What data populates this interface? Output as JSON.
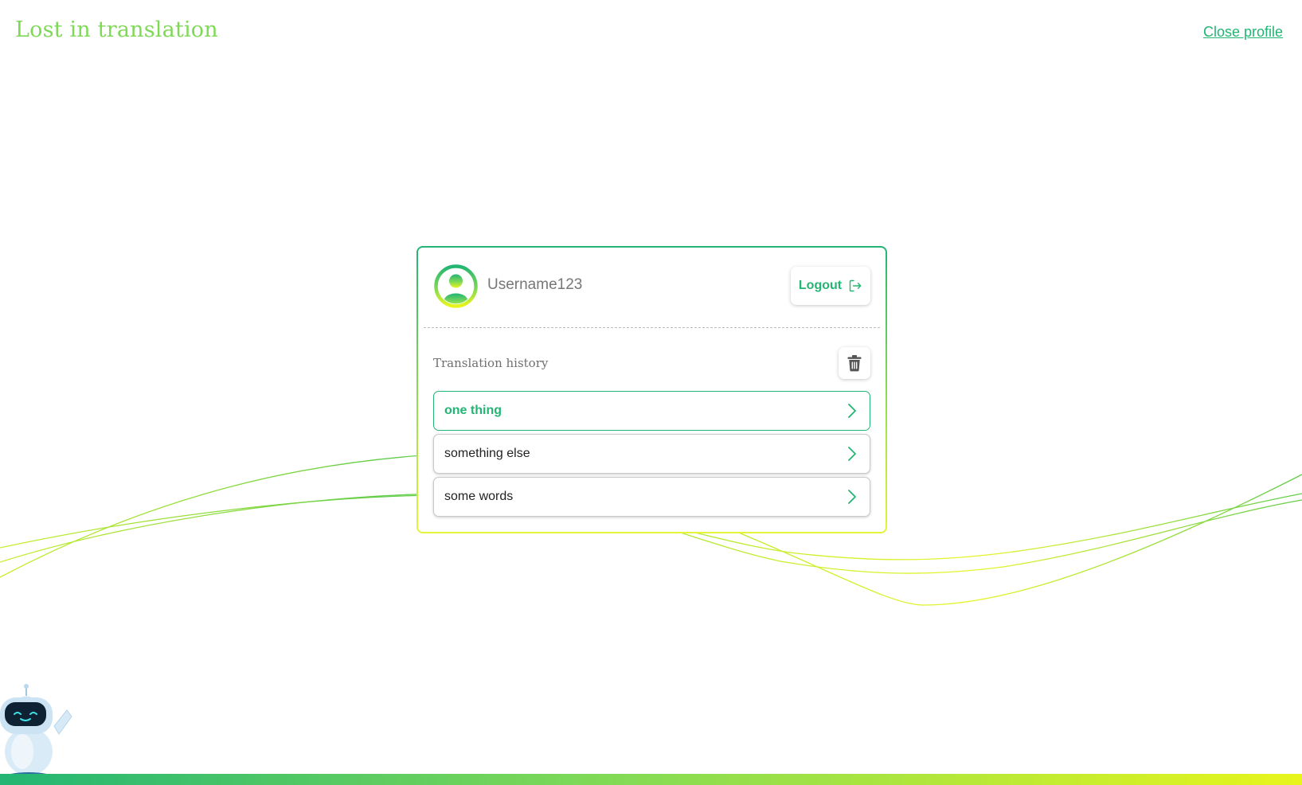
{
  "header": {
    "app_title": "Lost in translation",
    "close_profile_label": "Close profile"
  },
  "profile": {
    "username": "Username123",
    "logout_label": "Logout"
  },
  "history": {
    "title": "Translation history",
    "items": [
      {
        "label": "one thing",
        "active": true
      },
      {
        "label": "something else",
        "active": false
      },
      {
        "label": "some words",
        "active": false
      }
    ]
  },
  "icons": {
    "avatar": "user-circle-icon",
    "logout": "logout-icon",
    "trash": "trash-icon",
    "chevron": "chevron-right-icon",
    "mascot": "robot-mascot"
  },
  "colors": {
    "brand_green": "#22b573",
    "light_green": "#7ed957",
    "yellow": "#e8f51c",
    "text_gray": "#777777"
  }
}
